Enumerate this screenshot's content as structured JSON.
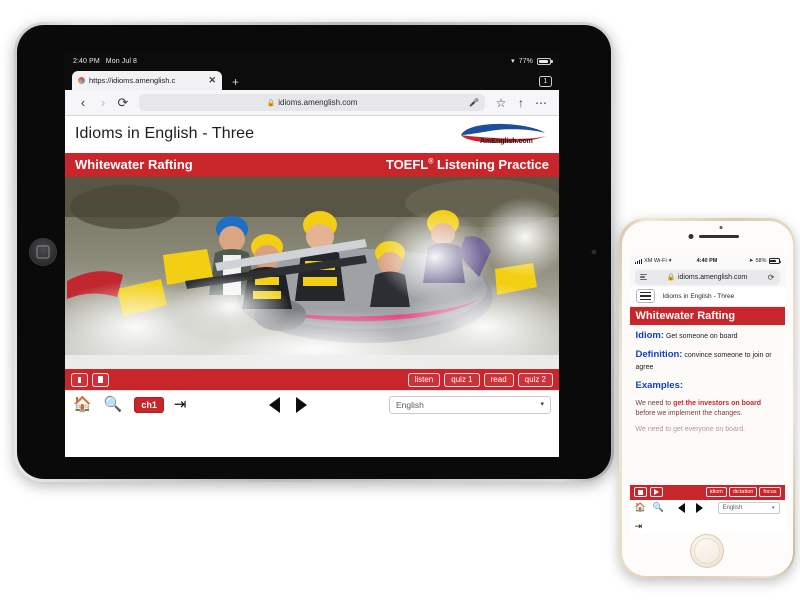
{
  "ipad": {
    "status_bar": {
      "time": "2:40 PM",
      "date": "Mon Jul 8",
      "wifi_icon": "wifi-icon",
      "battery_pct": "77%"
    },
    "browser": {
      "tab": {
        "title": "https://idioms.amenglish.c",
        "close_label": "✕",
        "favicon_name": "site-favicon"
      },
      "new_tab_label": "+",
      "tab_count": "1",
      "back_label": "‹",
      "forward_label": "›",
      "reload_label": "⟳",
      "url": "idioms.amenglish.com",
      "lock_label": "🔒",
      "mic_label": "🎤",
      "bookmark_label": "☆",
      "share_label": "↑",
      "more_label": "⋯"
    },
    "page": {
      "title": "Idioms in English - Three",
      "logo_text": "AmEnglish.com",
      "band_left": "Whitewater Rafting",
      "band_right_pre": "TOEFL",
      "band_right_sup": "®",
      "band_right_post": " Listening Practice",
      "photo_alt": "whitewater-rafting-photo",
      "media": {
        "stop_label": "stop",
        "pause_label": "pause",
        "buttons": [
          "listen",
          "quiz 1",
          "read",
          "quiz 2"
        ]
      },
      "nav": {
        "home_label": "🏠",
        "search_label": "🔍",
        "chapter_label": "ch1",
        "exit_label": "↪",
        "prev_label": "◀",
        "next_label": "▶",
        "language_value": "English",
        "language_caret": "↕"
      }
    }
  },
  "iphone": {
    "status_bar": {
      "carrier": "XM Wi-Fi",
      "time": "4:40 PM",
      "battery_pct": "58%",
      "location_icon": "location-arrow-icon"
    },
    "browser": {
      "reader_icon": "reader-view-icon",
      "lock_label": "🔒",
      "url": "idioms.amenglish.com",
      "reload_label": "⟳",
      "back_label": "‹",
      "forward_label": "›",
      "share_label": "↑",
      "bookmarks_label": "📖",
      "tabs_label": "⧉"
    },
    "page": {
      "menu_icon": "hamburger-menu-icon",
      "title": "Idioms in English - Three",
      "band": "Whitewater Rafting",
      "idiom_label": "Idiom:",
      "idiom_text": " Get someone on board",
      "definition_label": "Definition:",
      "definition_text": " convince someone to join or agree",
      "examples_label": "Examples:",
      "example_pre": "We need to ",
      "example_bold": "get the investors on board",
      "example_post": " before we implement the changes.",
      "example_cut": "We need to get everyone on board.",
      "media": {
        "stop_label": "stop",
        "play_label": "play",
        "buttons": [
          "idiom",
          "dictation",
          "focus"
        ]
      },
      "nav": {
        "home_label": "🏠",
        "search_label": "🔍",
        "prev_label": "◀",
        "next_label": "▶",
        "language_value": "English",
        "language_caret": "↕",
        "exit_label": "↪"
      }
    }
  },
  "colors": {
    "brand_red": "#c9262c",
    "label_blue": "#1240c4",
    "example_red": "#c9262c",
    "ios_blue": "#3478f6"
  }
}
